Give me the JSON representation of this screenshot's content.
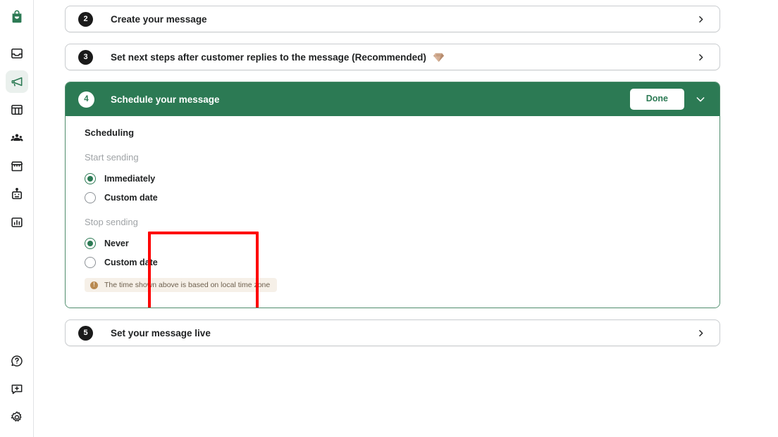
{
  "sidebar": {
    "top_items": [
      {
        "name": "shop-logo",
        "icon": "shopping-bag-icon",
        "label": "Shop",
        "active": false
      },
      {
        "name": "inbox",
        "icon": "inbox-icon",
        "label": "Inbox",
        "active": false
      },
      {
        "name": "campaigns",
        "icon": "megaphone-icon",
        "label": "Campaigns",
        "active": true
      },
      {
        "name": "dashboard",
        "icon": "layout-columns-icon",
        "label": "Dashboard",
        "active": false
      },
      {
        "name": "contacts",
        "icon": "people-icon",
        "label": "Contacts",
        "active": false
      },
      {
        "name": "store",
        "icon": "storefront-icon",
        "label": "Store",
        "active": false
      },
      {
        "name": "bots",
        "icon": "robot-icon",
        "label": "Bots",
        "active": false
      },
      {
        "name": "reports",
        "icon": "bar-chart-icon",
        "label": "Reports",
        "active": false
      }
    ],
    "bottom_items": [
      {
        "name": "help",
        "icon": "question-circle-icon",
        "label": "Help"
      },
      {
        "name": "feedback",
        "icon": "chat-plus-icon",
        "label": "Feedback"
      },
      {
        "name": "settings",
        "icon": "gear-icon",
        "label": "Settings"
      }
    ]
  },
  "steps": [
    {
      "number": "2",
      "title": "Create your message",
      "state": "collapsed",
      "premium": false,
      "chevron": "chevron-right-icon"
    },
    {
      "number": "3",
      "title": "Set next steps after customer replies to the message (Recommended)",
      "state": "collapsed",
      "premium": true,
      "premium_icon": "diamond-icon",
      "chevron": "chevron-right-icon"
    },
    {
      "number": "4",
      "title": "Schedule your message",
      "state": "expanded",
      "done_label": "Done",
      "chevron": "chevron-down-icon"
    },
    {
      "number": "5",
      "title": "Set your message live",
      "state": "collapsed",
      "premium": false,
      "chevron": "chevron-right-icon"
    }
  ],
  "scheduling": {
    "section_title": "Scheduling",
    "groups": [
      {
        "label": "Start sending",
        "options": [
          {
            "label": "Immediately",
            "selected": true
          },
          {
            "label": "Custom date",
            "selected": false
          }
        ]
      },
      {
        "label": "Stop sending",
        "options": [
          {
            "label": "Never",
            "selected": true
          },
          {
            "label": "Custom date",
            "selected": false
          }
        ]
      }
    ],
    "notice": {
      "icon": "info-circle-icon",
      "text": "The time shown above is based on local time zone"
    }
  },
  "colors": {
    "brand_green": "#2c7a54",
    "badge_dark": "#1a1a1a",
    "highlight_red": "#fe0000",
    "notice_bg": "#f6f0e8",
    "notice_fg": "#6d5f4d",
    "muted_text": "#9fa3a6"
  }
}
